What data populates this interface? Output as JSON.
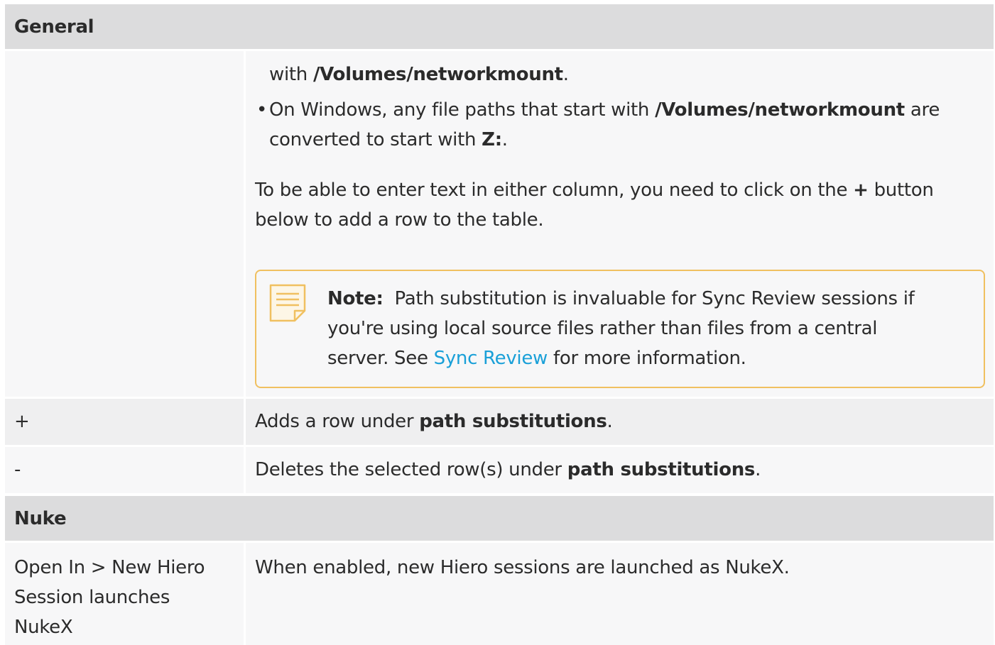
{
  "sections": {
    "general": {
      "title": "General"
    },
    "nuke": {
      "title": "Nuke"
    }
  },
  "path_subs": {
    "line1_pre": "with ",
    "line1_bold": "/Volumes/networkmount",
    "line1_post": ".",
    "bullet_char": "•",
    "line2_pre": "On Windows, any file paths that start with ",
    "line2_bold": "/Volumes/networkmount",
    "line2_post": " are",
    "line3_pre": "converted to start with ",
    "line3_bold": "Z:",
    "line3_post": ".",
    "para_line1_pre": "To be able to enter text in either column, you need to click on the ",
    "para_line1_bold": "+",
    "para_line1_post": " button",
    "para_line2": "below to add a row to the table."
  },
  "note": {
    "icon": "note-icon",
    "label": "Note:",
    "line1": "Path substitution is invaluable for Sync Review sessions if",
    "line2": "you're using local source files rather than files from a central",
    "line3_pre": "server. See ",
    "line3_link": "Sync Review",
    "line3_post": " for more information."
  },
  "rows": {
    "add": {
      "key": "+",
      "desc_pre": "Adds a row under ",
      "desc_bold": "path substitutions",
      "desc_post": "."
    },
    "remove": {
      "key": "-",
      "desc_pre": "Deletes the selected row(s) under ",
      "desc_bold": "path substitutions",
      "desc_post": "."
    },
    "open_in": {
      "key_line1": "Open In > New Hiero",
      "key_line2": "Session launches",
      "key_line3": "NukeX",
      "desc": "When enabled, new Hiero sessions are launched as NukeX."
    }
  },
  "colors": {
    "header_bg": "#dcdcdd",
    "note_border": "#f0c060",
    "link": "#1aa0d8"
  }
}
